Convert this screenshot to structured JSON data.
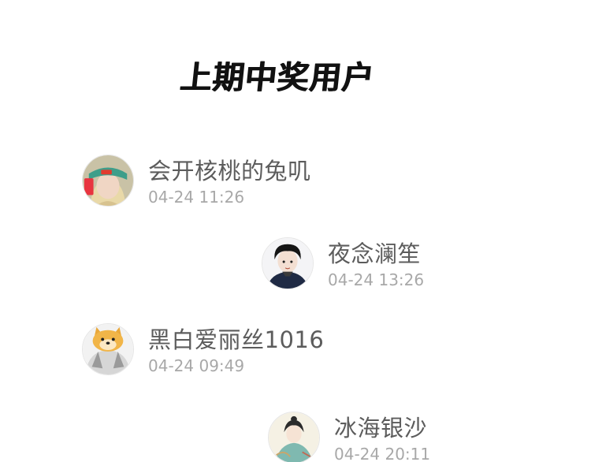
{
  "title": "上期中奖用户",
  "winners": [
    {
      "name": "会开核桃的兔叽",
      "time": "04-24 11:26",
      "avatar_icon": "girl-green-cap-avatar"
    },
    {
      "name": "夜念澜笙",
      "time": "04-24 13:26",
      "avatar_icon": "boy-dark-hair-avatar"
    },
    {
      "name": "黑白爱丽丝1016",
      "time": "04-24 09:49",
      "avatar_icon": "shiba-dog-avatar"
    },
    {
      "name": "冰海银沙",
      "time": "04-24 20:11",
      "avatar_icon": "ancient-style-lady-avatar"
    }
  ]
}
